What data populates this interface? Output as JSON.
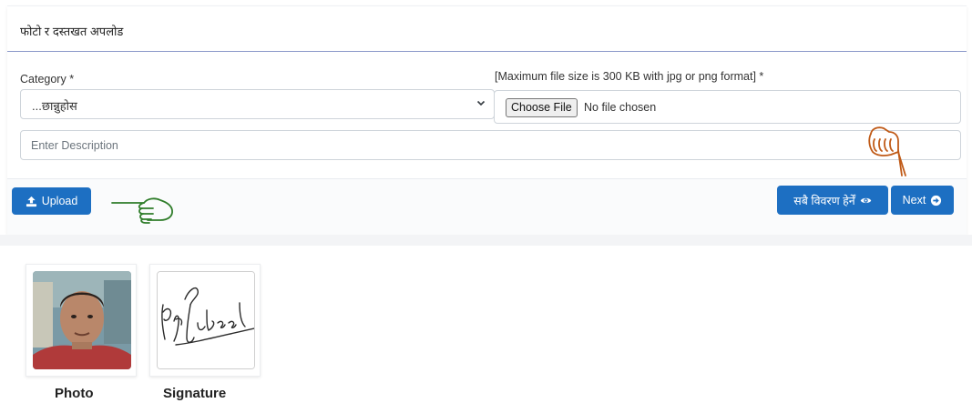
{
  "section": {
    "title": "फोटो र दस्तखत अपलोड"
  },
  "form": {
    "category_label": "Category *",
    "category_value": "...छान्नुहोस",
    "file_label": "[Maximum file size is 300 KB with jpg or png format] *",
    "file_button": "Choose File",
    "file_status": "No file chosen",
    "description_placeholder": "Enter Description"
  },
  "actions": {
    "upload_label": "Upload",
    "preview_label": "सबै विवरण हेर्नें",
    "next_label": "Next"
  },
  "uploads": [
    {
      "caption": "Photo",
      "icon": "photo-thumbnail"
    },
    {
      "caption": "Signature",
      "icon": "signature-thumbnail"
    }
  ],
  "colors": {
    "primary": "#1d6fc2",
    "annotation_pointer": "#c05a17",
    "annotation_pointer_green": "#2f7d2a"
  }
}
